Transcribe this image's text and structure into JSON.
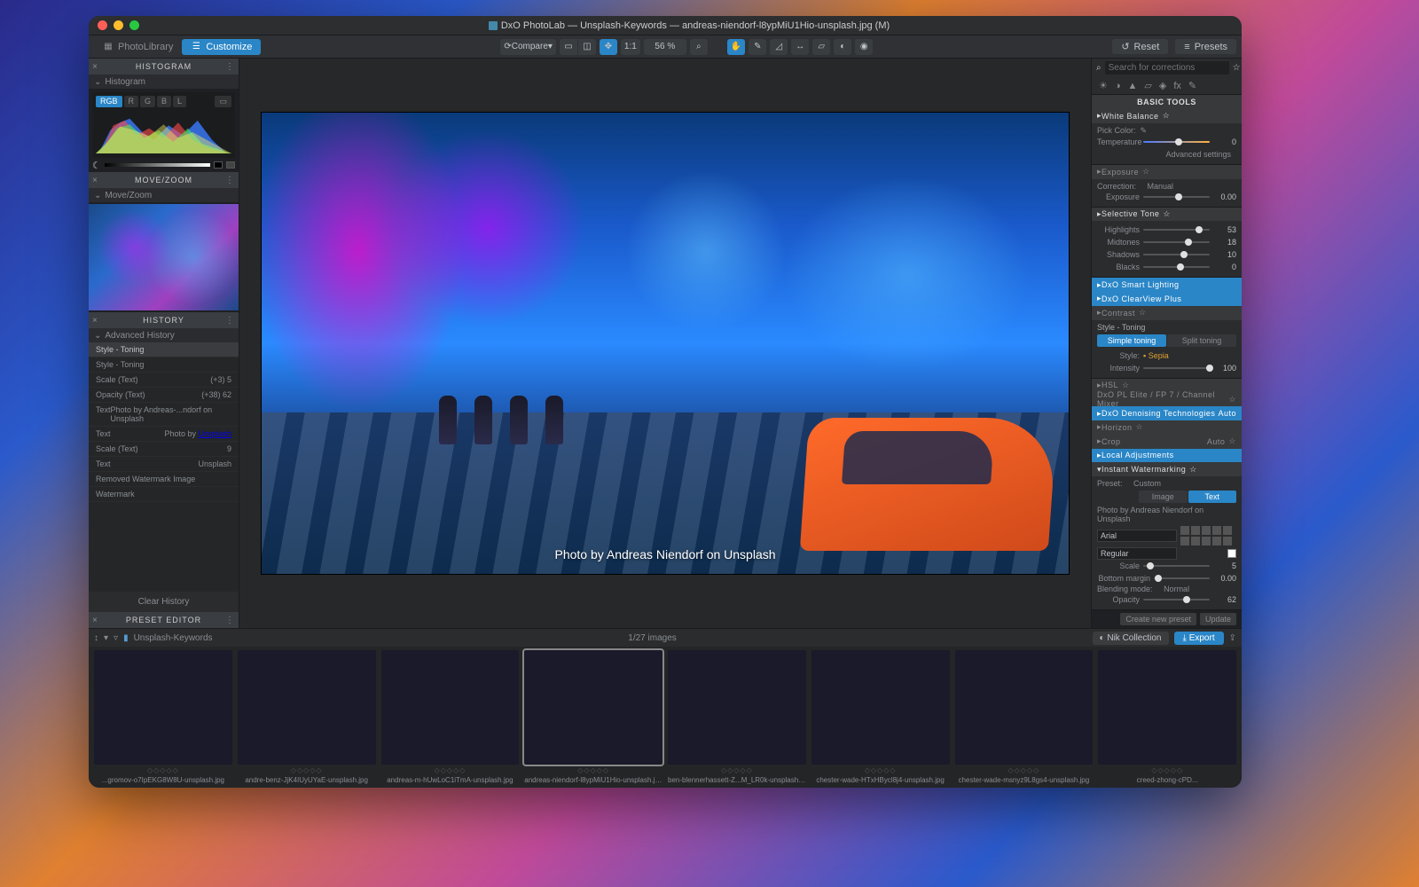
{
  "window_title": "DxO PhotoLab — Unsplash-Keywords — andreas-niendorf-l8ypMiU1Hio-unsplash.jpg (M)",
  "tabs": {
    "library": "PhotoLibrary",
    "customize": "Customize"
  },
  "toolbar": {
    "compare": "Compare",
    "ratio": "1:1",
    "zoom": "56 %",
    "reset": "Reset",
    "presets": "Presets"
  },
  "panels": {
    "histogram": {
      "title": "HISTOGRAM",
      "sub": "Histogram",
      "tabs": [
        "RGB",
        "R",
        "G",
        "B",
        "L"
      ]
    },
    "movezoom": {
      "title": "MOVE/ZOOM",
      "sub": "Move/Zoom"
    },
    "history": {
      "title": "HISTORY",
      "sub": "Advanced History",
      "rows": [
        {
          "label": "Style - Toning",
          "val": "",
          "hi": true
        },
        {
          "label": "Style - Toning",
          "val": "",
          "dot": true
        },
        {
          "label": "Scale (Text)",
          "val": "(+3)  5"
        },
        {
          "label": "Opacity (Text)",
          "val": "(+38)  62"
        },
        {
          "label": "Text",
          "val": "Photo by Andreas-...ndorf on Unsplash"
        },
        {
          "label": "Text",
          "val": "Photo by <a href=...lash'>Unsplash</a>"
        },
        {
          "label": "Scale (Text)",
          "val": "9"
        },
        {
          "label": "Text",
          "val": "Unsplash"
        },
        {
          "label": "Removed Watermark Image",
          "val": ""
        },
        {
          "label": "Watermark",
          "val": ""
        }
      ],
      "clear": "Clear History"
    },
    "preset_editor": {
      "title": "PRESET EDITOR"
    }
  },
  "right": {
    "search_placeholder": "Search for corrections",
    "basic_tools": "BASIC TOOLS",
    "white_balance": {
      "title": "White Balance",
      "pick": "Pick Color:",
      "temperature_label": "Temperature",
      "temperature_val": "0",
      "advanced": "Advanced settings"
    },
    "exposure": {
      "title": "Exposure",
      "correction": "Correction:",
      "correction_val": "Manual",
      "exposure_label": "Exposure",
      "exposure_val": "0.00"
    },
    "selective_tone": {
      "title": "Selective Tone",
      "rows": [
        {
          "label": "Highlights",
          "val": "53",
          "pos": 0.78
        },
        {
          "label": "Midtones",
          "val": "18",
          "pos": 0.62
        },
        {
          "label": "Shadows",
          "val": "10",
          "pos": 0.56
        },
        {
          "label": "Blacks",
          "val": "0",
          "pos": 0.5
        }
      ]
    },
    "smart_lighting": "DxO Smart Lighting",
    "clearview": "DxO ClearView Plus",
    "contrast": "Contrast",
    "style_toning": {
      "title": "Style - Toning",
      "simple": "Simple toning",
      "split": "Split toning",
      "style_label": "Style:",
      "style_val": "Sepia",
      "intensity_label": "Intensity",
      "intensity_val": "100"
    },
    "hsl": "HSL",
    "filmpack": "DxO PL Elite / FP 7 / Channel Mixer",
    "denoise": {
      "title": "DxO Denoising Technologies",
      "auto": "Auto"
    },
    "horizon": "Horizon",
    "crop": {
      "title": "Crop",
      "auto": "Auto"
    },
    "local": "Local Adjustments",
    "watermark": {
      "title": "Instant Watermarking",
      "preset_label": "Preset:",
      "preset_val": "Custom",
      "image": "Image",
      "text": "Text",
      "sample": "Photo by Andreas Niendorf on Unsplash",
      "font": "Arial",
      "weight": "Regular",
      "scale_label": "Scale",
      "scale_val": "5",
      "margin_label": "Bottom margin",
      "margin_val": "0.00",
      "blend_label": "Blending mode:",
      "blend_val": "Normal",
      "opacity_label": "Opacity",
      "opacity_val": "62",
      "create": "Create new preset",
      "update": "Update"
    }
  },
  "viewer": {
    "watermark": "Photo by Andreas Niendorf on Unsplash"
  },
  "strip": {
    "folder": "Unsplash-Keywords",
    "count": "1/27 images",
    "nik": "Nik Collection",
    "export": "Export",
    "thumbs": [
      "...gromov-o7IpEKG8W8U-unsplash.jpg",
      "andre-benz-JjK4IUyUYaE-unsplash.jpg",
      "andreas-m-hUwLoC1iTmA-unsplash.jpg",
      "andreas-niendorf-l8ypMiU1Hio-unsplash.jpg",
      "ben-blennerhassett-Z...M_LR0k-unsplash.jpg",
      "chester-wade-HTxHBycl8j4-unsplash.jpg",
      "chester-wade-msnyz9L8gs4-unsplash.jpg",
      "creed-zhong-cPD..."
    ]
  }
}
